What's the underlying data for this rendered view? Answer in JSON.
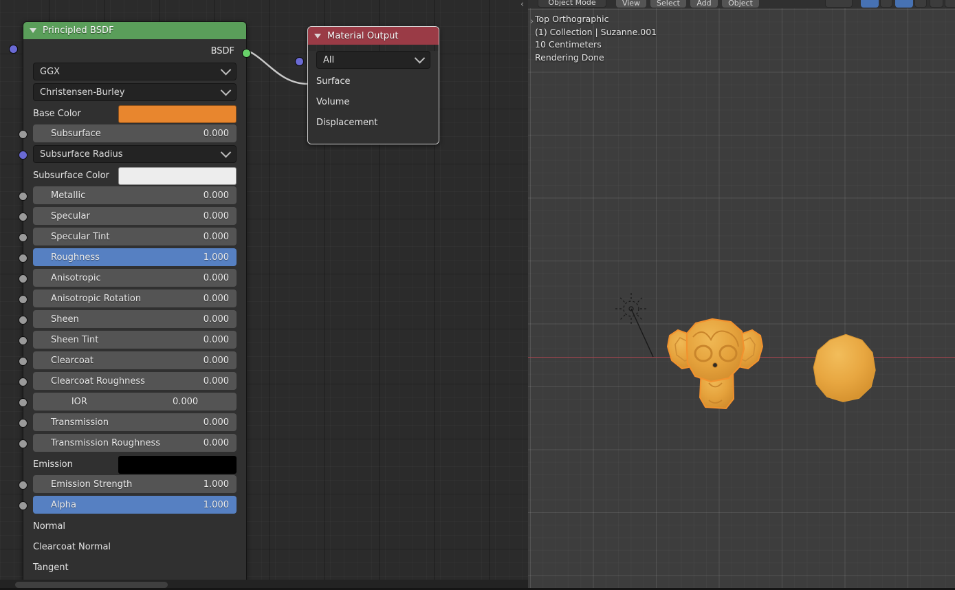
{
  "app": "Blender",
  "node_editor": {
    "nodes": [
      {
        "id": "principled-bsdf",
        "title": "Principled BSDF",
        "header_color": "#5a9e5a",
        "outputs": [
          {
            "label": "BSDF",
            "socket": "shader",
            "color": "#68d16a"
          }
        ],
        "dropdowns": [
          {
            "label": "GGX"
          },
          {
            "label": "Christensen-Burley"
          }
        ],
        "inputs": [
          {
            "label": "Base Color",
            "kind": "color",
            "value": "#e8862e",
            "socket": "color"
          },
          {
            "label": "Subsurface",
            "kind": "slider",
            "value": "0.000",
            "socket": "gray"
          },
          {
            "label": "Subsurface Radius",
            "kind": "dropdown",
            "value": "",
            "socket": "vector"
          },
          {
            "label": "Subsurface Color",
            "kind": "color",
            "value": "#ededed",
            "socket": "color"
          },
          {
            "label": "Metallic",
            "kind": "slider",
            "value": "0.000",
            "socket": "gray"
          },
          {
            "label": "Specular",
            "kind": "slider",
            "value": "0.000",
            "socket": "gray"
          },
          {
            "label": "Specular Tint",
            "kind": "slider",
            "value": "0.000",
            "socket": "gray"
          },
          {
            "label": "Roughness",
            "kind": "slider",
            "value": "1.000",
            "socket": "gray",
            "active": true
          },
          {
            "label": "Anisotropic",
            "kind": "slider",
            "value": "0.000",
            "socket": "gray"
          },
          {
            "label": "Anisotropic Rotation",
            "kind": "slider",
            "value": "0.000",
            "socket": "gray"
          },
          {
            "label": "Sheen",
            "kind": "slider",
            "value": "0.000",
            "socket": "gray"
          },
          {
            "label": "Sheen Tint",
            "kind": "slider",
            "value": "0.000",
            "socket": "gray"
          },
          {
            "label": "Clearcoat",
            "kind": "slider",
            "value": "0.000",
            "socket": "gray"
          },
          {
            "label": "Clearcoat Roughness",
            "kind": "slider",
            "value": "0.000",
            "socket": "gray"
          },
          {
            "label": "IOR",
            "kind": "slider",
            "value": "0.000",
            "socket": "gray"
          },
          {
            "label": "Transmission",
            "kind": "slider",
            "value": "0.000",
            "socket": "gray"
          },
          {
            "label": "Transmission Roughness",
            "kind": "slider",
            "value": "0.000",
            "socket": "gray"
          },
          {
            "label": "Emission",
            "kind": "color",
            "value": "#000000",
            "socket": "color"
          },
          {
            "label": "Emission Strength",
            "kind": "slider",
            "value": "1.000",
            "socket": "gray"
          },
          {
            "label": "Alpha",
            "kind": "slider",
            "value": "1.000",
            "socket": "gray",
            "active": true
          },
          {
            "label": "Normal",
            "kind": "plain",
            "value": "",
            "socket": "vector"
          },
          {
            "label": "Clearcoat Normal",
            "kind": "plain",
            "value": "",
            "socket": "vector"
          },
          {
            "label": "Tangent",
            "kind": "plain",
            "value": "",
            "socket": "vector"
          }
        ]
      },
      {
        "id": "material-output",
        "title": "Material Output",
        "header_color": "#9a3b46",
        "dropdowns": [
          {
            "label": "All"
          }
        ],
        "inputs": [
          {
            "label": "Surface",
            "socket": "shader"
          },
          {
            "label": "Volume",
            "socket": "shader"
          },
          {
            "label": "Displacement",
            "socket": "vector"
          }
        ]
      }
    ]
  },
  "viewport": {
    "header": {
      "mode": "Object Mode",
      "menus": [
        "View",
        "Select",
        "Add",
        "Object"
      ]
    },
    "overlay": [
      "Top Orthographic",
      "(1) Collection | Suzanne.001",
      "10 Centimeters",
      "Rendering Done"
    ],
    "objects": [
      {
        "name": "Suzanne.001",
        "type": "mesh-monkey",
        "selected": true
      },
      {
        "name": "Sphere",
        "type": "mesh-sphere",
        "selected": false
      },
      {
        "name": "Light",
        "type": "point-light",
        "selected": false
      }
    ]
  },
  "colors": {
    "accent_orange": "#e8862e",
    "accent_blue": "#5680c2",
    "shader_socket": "#68d16a",
    "vector_socket": "#6a6ad4",
    "color_socket": "#e2e234",
    "value_socket": "#9a9a9a",
    "axis_x": "#a6454f",
    "object_orange": "#e8a33d"
  }
}
